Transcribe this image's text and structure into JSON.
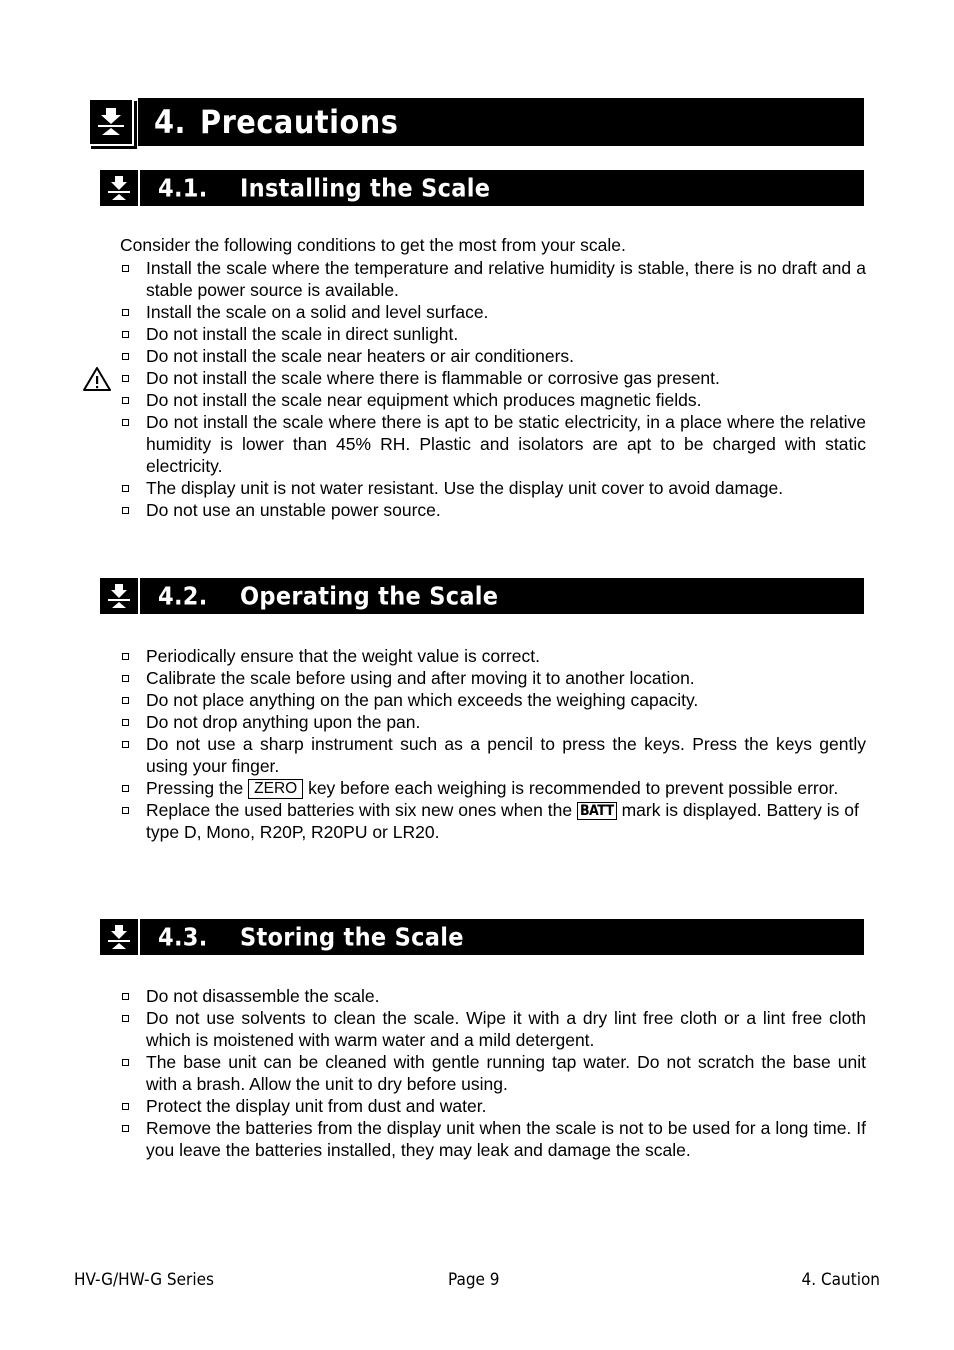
{
  "document": {
    "chapter_number": "4.",
    "chapter_title": "Precautions"
  },
  "sections": [
    {
      "number": "4.1.",
      "title": "Installing the Scale",
      "intro": "Consider the following conditions to get the most from your scale.",
      "bullets": [
        "Install the scale where the temperature and relative humidity is stable, there is no draft and a stable power source is available.",
        "Install the scale on a solid and level surface.",
        "Do not install the scale in direct sunlight.",
        "Do not install the scale near heaters or air conditioners.",
        "Do not install the scale where there is flammable or corrosive gas present.",
        "Do not install the scale near equipment which produces magnetic fields.",
        "Do not install the scale where there is apt to be static electricity, in a place where the relative humidity is lower than 45% RH. Plastic and isolators are apt to be charged with static electricity.",
        "The display unit is not water resistant. Use the display unit cover to avoid damage.",
        "Do not use an unstable power source."
      ]
    },
    {
      "number": "4.2.",
      "title": "Operating the Scale",
      "bullets": [
        "Periodically ensure that the weight value is correct.",
        "Calibrate the scale before using and after moving it to another location.",
        "Do not place anything on the pan which exceeds the weighing capacity.",
        "Do not drop anything upon the pan.",
        "Do not use a sharp instrument such as a pencil to press the keys. Press the keys gently using your finger."
      ],
      "zero_bullet": {
        "before": "Pressing the ",
        "key": "ZERO",
        "after": " key before each weighing is recommended to prevent possible error."
      },
      "batt_bullet": {
        "before": "Replace the used batteries with six new ones when the ",
        "key": "BATT",
        "after": " mark is displayed. Battery is of type D, Mono, R20P, R20PU or LR20."
      }
    },
    {
      "number": "4.3.",
      "title": "Storing the Scale",
      "bullets": [
        "Do not disassemble the scale.",
        "Do not use solvents to clean the scale. Wipe it with a dry lint free cloth or a lint free cloth which is moistened with warm water and a mild detergent.",
        "The base unit can be cleaned with gentle running tap water. Do not scratch the base unit with a brash. Allow the unit to dry before using.",
        "Protect the display unit from dust and water.",
        "Remove the batteries from the display unit when the scale is not to be used for a long time. If you leave the batteries installed, they may leak and damage the scale."
      ]
    }
  ],
  "icons": {
    "heading_icon": "scale-weighing-icon",
    "warning_icon": "warning-triangle-icon"
  },
  "footer": {
    "left": "HV-G/HW-G Series",
    "center": "Page 9",
    "right": "4. Caution"
  }
}
